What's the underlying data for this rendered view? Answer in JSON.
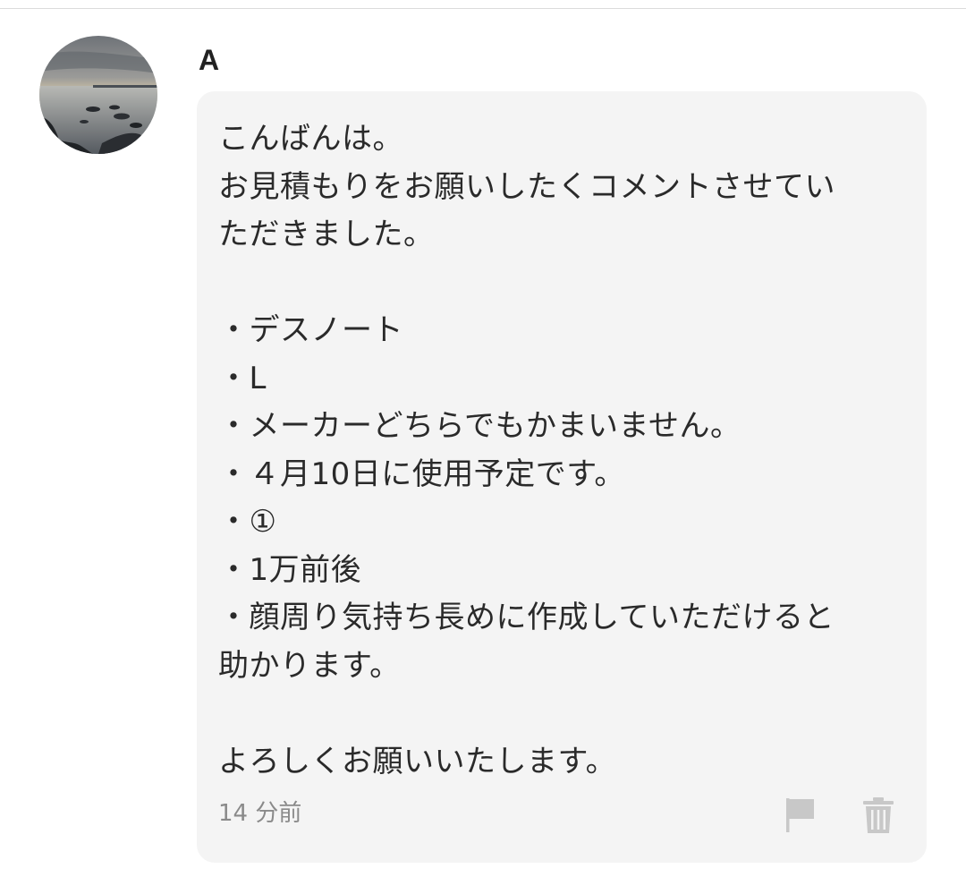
{
  "comment": {
    "author": "A",
    "avatar_icon": "user-avatar-photo",
    "message_lines": [
      "こんばんは。",
      "お見積もりをお願いしたくコメントさせてい",
      "ただきました。",
      "",
      "・デスノート",
      "・L",
      "・メーカーどちらでもかまいません。",
      "・４月10日に使用予定です。",
      "・①",
      "・1万前後",
      "・顔周り気持ち長めに作成していただけると",
      "助かります。",
      "",
      "よろしくお願いいたします。"
    ],
    "timestamp": "14 分前",
    "actions": {
      "report_icon": "flag-icon",
      "delete_icon": "trash-icon"
    }
  },
  "colors": {
    "bubble_bg": "#f4f4f4",
    "text": "#2a2a2a",
    "muted": "#8a8a8a",
    "icon": "#c8c8c8"
  }
}
